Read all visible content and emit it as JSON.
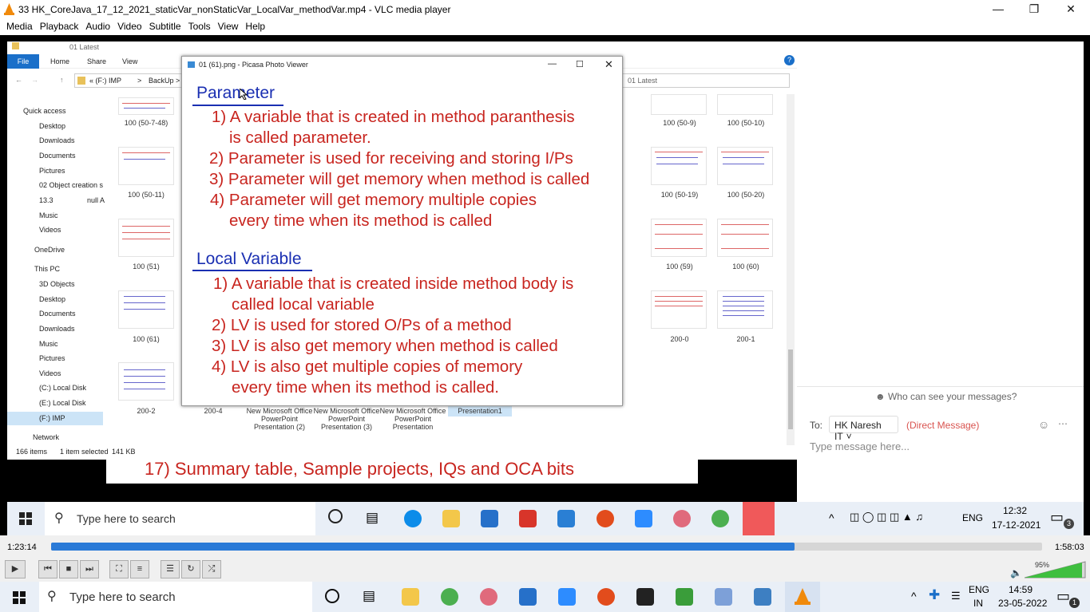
{
  "window": {
    "title": "33 HK_CoreJava_17_12_2021_staticVar_nonStaticVar_LocalVar_methodVar.mp4 - VLC media player"
  },
  "menu": [
    "Media",
    "Playback",
    "Audio",
    "Video",
    "Subtitle",
    "Tools",
    "View",
    "Help"
  ],
  "explorer": {
    "path_title": "01 Latest",
    "tabs": [
      "File",
      "Home",
      "Share",
      "View"
    ],
    "address": [
      "« (F:) IMP",
      ">",
      "BackUp",
      ">",
      "01"
    ],
    "search_placeholder": "01 Latest",
    "sidebar": [
      "Quick access",
      "Desktop",
      "Downloads",
      "Documents",
      "Pictures",
      "02 Object creation s",
      "13.3",
      "Music",
      "Videos",
      "OneDrive",
      "This PC",
      "3D Objects",
      "Desktop",
      "Documents",
      "Downloads",
      "Music",
      "Pictures",
      "Videos",
      "(C:) Local Disk",
      "(E:) Local Disk",
      "(F:) IMP",
      "Network"
    ],
    "null_label": "null A",
    "files_left": [
      "100 (50-7-48)",
      "100 (50-11)",
      "100 (51)",
      "100 (61)",
      "200-2",
      "200-4"
    ],
    "files_right": [
      "100 (50-9)",
      "100 (50-10)",
      "100 (50-19)",
      "100 (50-20)",
      "100 (59)",
      "100 (60)",
      "200-0",
      "200-1"
    ],
    "partial_labels": [
      "8)",
      "48)",
      "0)"
    ],
    "pptx": [
      "New Microsoft Office PowerPoint Presentation (2)",
      "New Microsoft Office PowerPoint Presentation (3)",
      "New Microsoft Office PowerPoint Presentation"
    ],
    "selected": "Presentation1",
    "status": {
      "count": "166 items",
      "selected": "1 item selected",
      "size": "141 KB"
    }
  },
  "picasa": {
    "title": "01 (61).png - Picasa Photo Viewer",
    "heading1": "Parameter",
    "p_lines": [
      "1) A variable that is created in method paranthesis",
      "is called parameter.",
      "2) Parameter is used for receiving and storing I/Ps",
      "3) Parameter will get memory when method is called",
      "4) Parameter will get memory multiple copies",
      "every time when its method is called"
    ],
    "heading2": "Local Variable",
    "lv_lines": [
      "1) A variable that is created inside method body is",
      "called local variable",
      "2) LV is used for stored O/Ps of a method",
      "3) LV is also get memory when method is called",
      "4) LV is also get multiple copies of memory",
      "every time when its method is called."
    ]
  },
  "banner": "17) Summary table, Sample projects, IQs and OCA bits",
  "chat": {
    "who": "Who can see your messages?",
    "to_label": "To:",
    "recipient": "HK Naresh IT",
    "direct": "(Direct Message)",
    "placeholder": "Type message here..."
  },
  "inner_taskbar": {
    "search": "Type here to search",
    "lang": "ENG",
    "time": "12:32",
    "date": "17-12-2021",
    "badge": "3"
  },
  "player": {
    "elapsed": "1:23:14",
    "total": "1:58:03",
    "progress": 0.75,
    "volume": "95%"
  },
  "outer_taskbar": {
    "search": "Type here to search",
    "lang": "ENG",
    "region": "IN",
    "time": "14:59",
    "date": "23-05-2022",
    "badge": "1"
  }
}
